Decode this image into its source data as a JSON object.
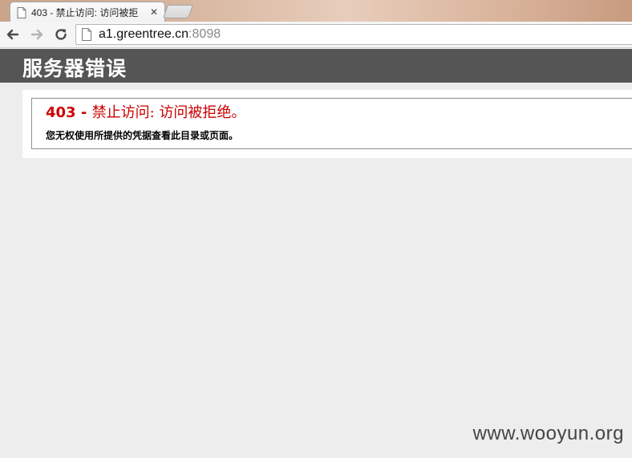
{
  "browser": {
    "tab": {
      "title": "403 - 禁止访问: 访问被拒",
      "close_glyph": "✕"
    },
    "address_bar": {
      "host": "a1.greentree.cn",
      "port": ":8098"
    },
    "icons": [
      "back-arrow-icon",
      "forward-arrow-icon",
      "reload-icon",
      "page-icon",
      "favicon"
    ]
  },
  "page": {
    "header": {
      "title": "服务器错误"
    },
    "error": {
      "code": "403",
      "separator": " - ",
      "title": "禁止访问: 访问被拒绝。",
      "description": "您无权使用所提供的凭据查看此目录或页面。"
    }
  },
  "watermark": {
    "text": "www.wooyun.org"
  },
  "colors": {
    "header_bg": "#555555",
    "error_red": "#cc0000",
    "page_bg": "#ededed"
  }
}
